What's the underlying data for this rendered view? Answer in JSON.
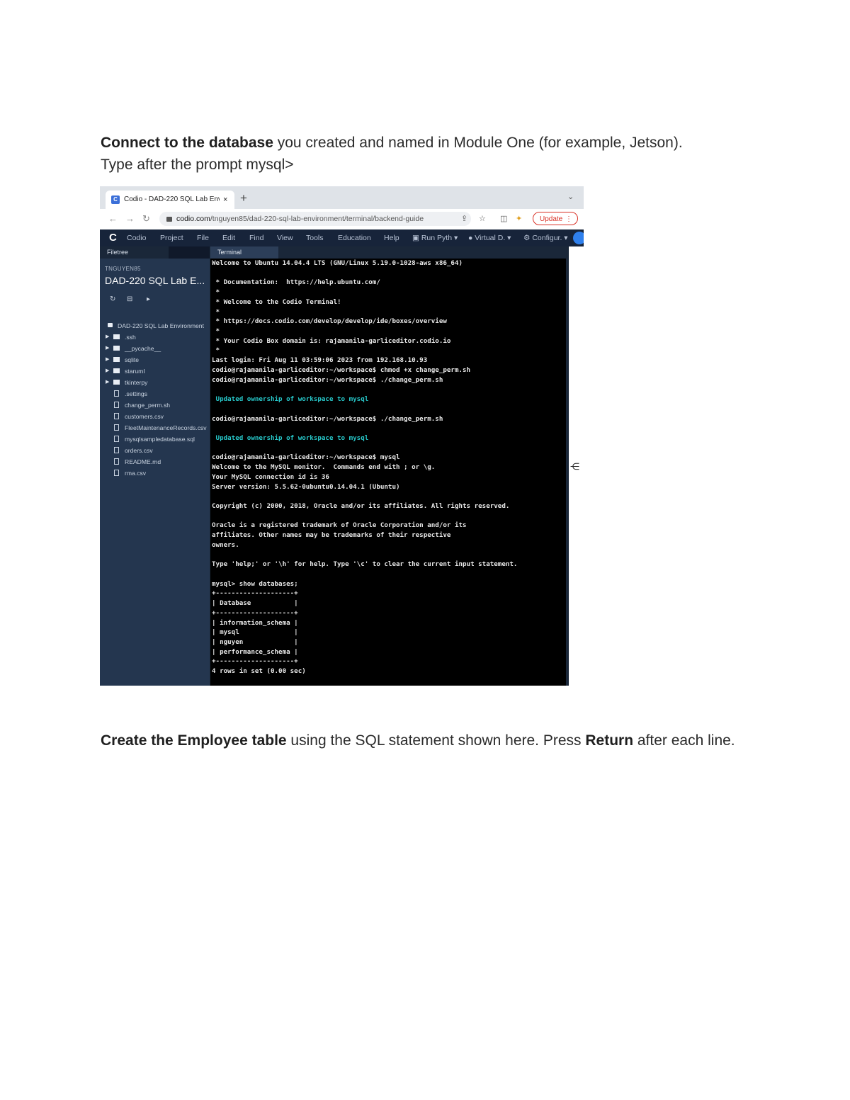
{
  "document": {
    "para1": {
      "bold": "Connect to the database",
      "rest": " you created and named in Module One (for example, Jetson).",
      "line2": "Type after the prompt mysql>"
    },
    "para2": {
      "bold1": "Create the Employee table",
      "mid": " using the SQL statement shown here. Press ",
      "bold2": "Return",
      "end": " after each line."
    }
  },
  "browser": {
    "tab_title": "Codio - DAD-220 SQL Lab Env",
    "tab_close": "×",
    "new_tab": "+",
    "url_host": "codio.com",
    "url_path": "/tnguyen85/dad-220-sql-lab-environment/terminal/backend-guide",
    "update_label": "Update"
  },
  "menubar": {
    "logo": "C",
    "items": [
      "Codio",
      "Project",
      "File",
      "Edit",
      "Find",
      "View",
      "Tools",
      "Education",
      "Help"
    ],
    "run": "Run Pyth",
    "virtual": "Virtual D.",
    "config": "Configur."
  },
  "filetree": {
    "header": "Filetree",
    "user": "TNGUYEN85",
    "project": "DAD-220 SQL Lab E...",
    "root": "DAD-220 SQL Lab Environment",
    "folders": [
      ".ssh",
      "__pycache__",
      "sqlite",
      "starumI",
      "tkinterpy"
    ],
    "files": [
      ".settings",
      "change_perm.sh",
      "customers.csv",
      "FleetMaintenanceRecords.csv",
      "mysqlsampledatabase.sql",
      "orders.csv",
      "README.md",
      "rma.csv"
    ]
  },
  "terminal": {
    "tab": "Terminal",
    "lines": [
      "Welcome to Ubuntu 14.04.4 LTS (GNU/Linux 5.19.0-1028-aws x86_64)",
      "",
      " * Documentation:  https://help.ubuntu.com/",
      " *",
      " * Welcome to the Codio Terminal!",
      " *",
      " * https://docs.codio.com/develop/develop/ide/boxes/overview",
      " *",
      " * Your Codio Box domain is: rajamanila-garliceditor.codio.io",
      " *",
      "Last login: Fri Aug 11 03:59:06 2023 from 192.168.10.93",
      "codio@rajamanila-garliceditor:~/workspace$ chmod +x change_perm.sh",
      "codio@rajamanila-garliceditor:~/workspace$ ./change_perm.sh",
      "",
      " Updated ownership of workspace to mysql",
      "",
      "codio@rajamanila-garliceditor:~/workspace$ ./change_perm.sh",
      "",
      " Updated ownership of workspace to mysql",
      "",
      "codio@rajamanila-garliceditor:~/workspace$ mysql",
      "Welcome to the MySQL monitor.  Commands end with ; or \\g.",
      "Your MySQL connection id is 36",
      "Server version: 5.5.62-0ubuntu0.14.04.1 (Ubuntu)",
      "",
      "Copyright (c) 2000, 2018, Oracle and/or its affiliates. All rights reserved.",
      "",
      "Oracle is a registered trademark of Oracle Corporation and/or its",
      "affiliates. Other names may be trademarks of their respective",
      "owners.",
      "",
      "Type 'help;' or '\\h' for help. Type '\\c' to clear the current input statement.",
      "",
      "mysql> show databases;",
      "+--------------------+",
      "| Database           |",
      "+--------------------+",
      "| information_schema |",
      "| mysql              |",
      "| nguyen             |",
      "| performance_schema |",
      "+--------------------+",
      "4 rows in set (0.00 sec)"
    ],
    "highlight_color": "#27c7c9"
  }
}
